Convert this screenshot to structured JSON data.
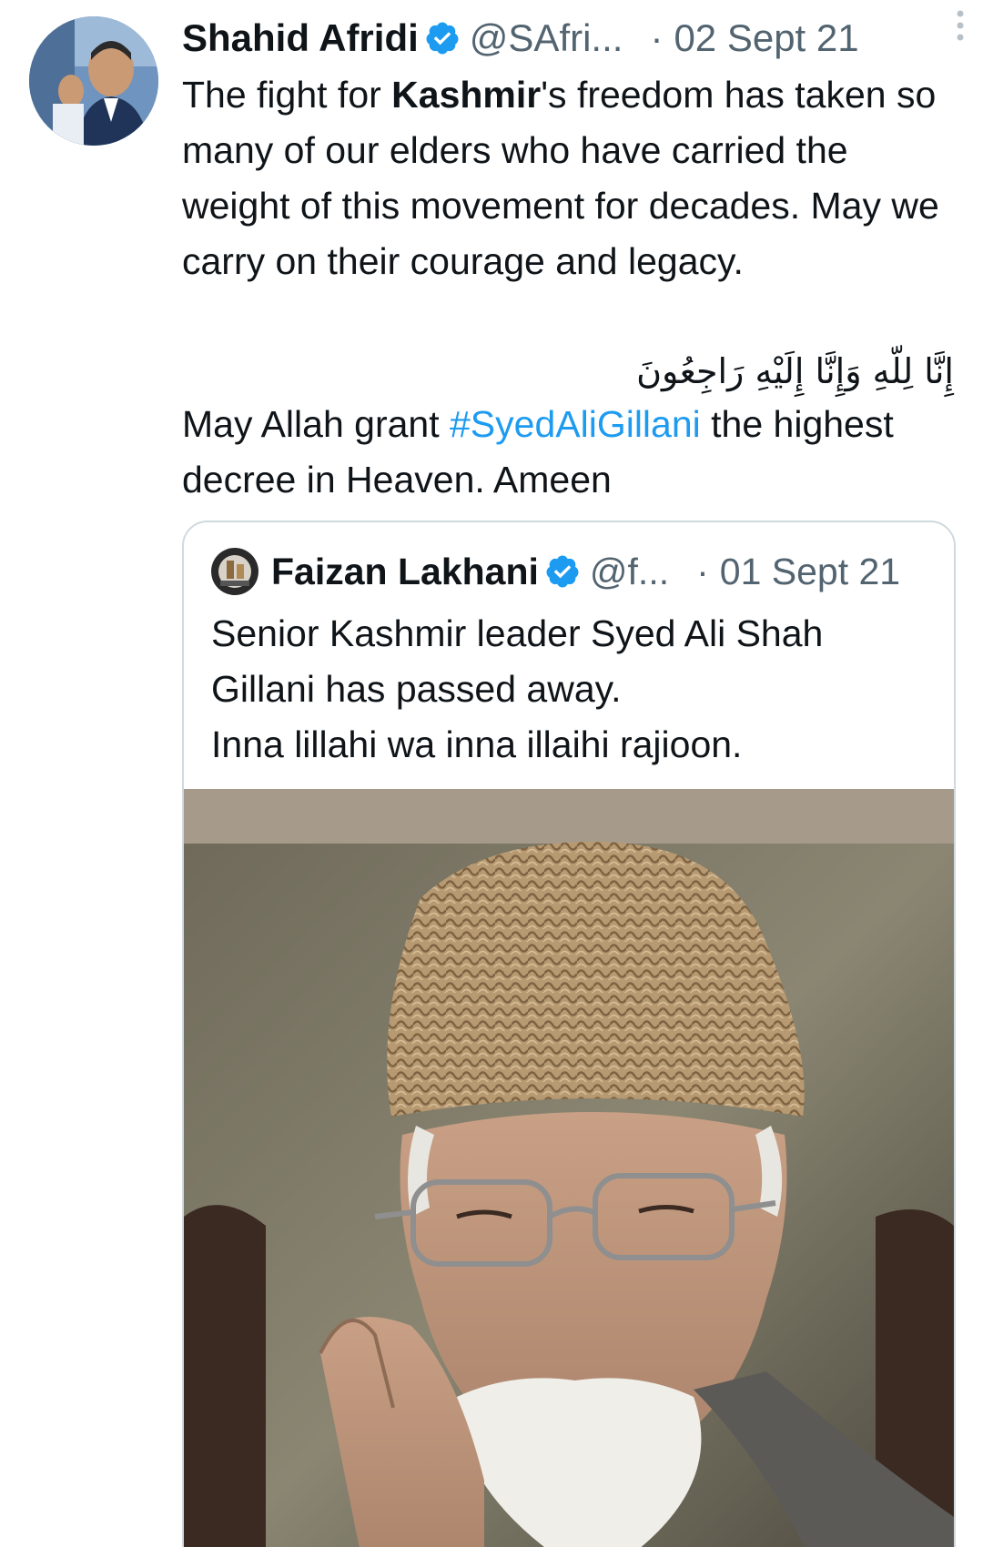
{
  "tweet": {
    "author_name": "Shahid Afridi",
    "handle": "@SAfri...",
    "separator": "·",
    "date": "02 Sept 21",
    "text_line1_before": "The fight for ",
    "text_keyword": "Kashmir",
    "text_line1_after": "'s freedom has",
    "text_rest": "taken so many of our elders who have carried the weight of this movement for decades. May we carry on their courage and legacy.",
    "arabic_line": "إِنَّا لِلّهِ وَإِنَّا إِلَيْهِ رَاجِعُونَ",
    "prayer_before": "May Allah grant ",
    "hashtag": "#SyedAliGillani",
    "prayer_after": " the highest decree in Heaven. Ameen",
    "icons": {
      "verified": "verified-badge-icon",
      "more": "more-options-icon"
    }
  },
  "quoted": {
    "author_name": "Faizan Lakhani",
    "handle": "@f...",
    "separator": "·",
    "date": "01 Sept 21",
    "line1": "Senior Kashmir leader Syed Ali Shah",
    "line2": "Gillani has passed away.",
    "line3": "Inna lillahi wa inna illaihi rajioon."
  },
  "colors": {
    "text": "#0f1419",
    "secondary": "#536471",
    "link": "#1d9bf0",
    "verified": "#1d9bf0",
    "border": "#cfd9de"
  }
}
